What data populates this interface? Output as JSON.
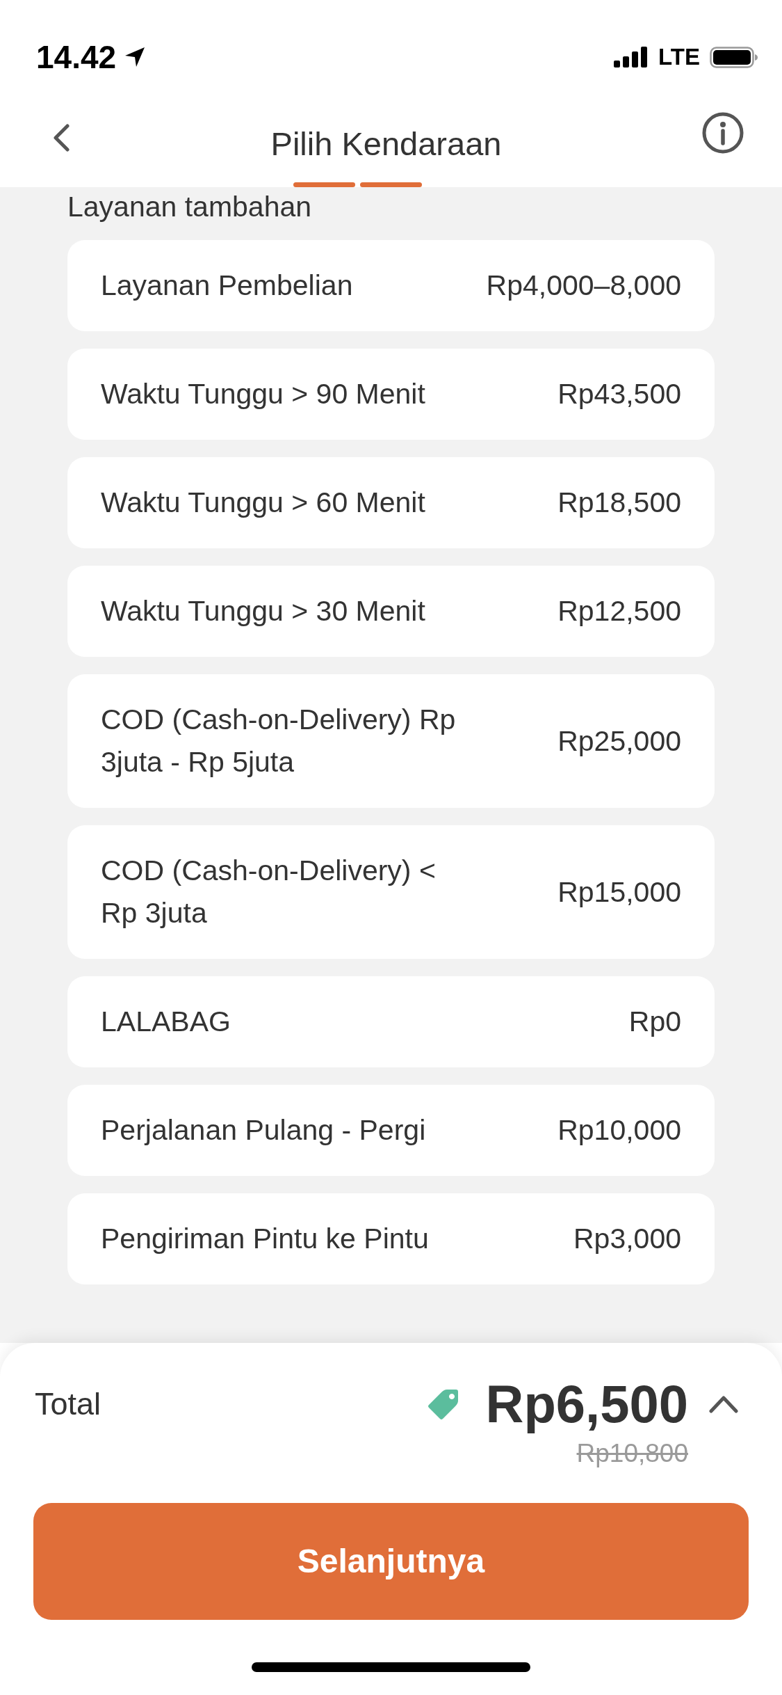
{
  "status_bar": {
    "time": "14.42",
    "network": "LTE"
  },
  "header": {
    "title": "Pilih Kendaraan",
    "steps": [
      {
        "done": true
      },
      {
        "done": true
      }
    ]
  },
  "section": {
    "title": "Layanan tambahan",
    "services": [
      {
        "name": "Layanan Pembelian",
        "price": "Rp4,000–8,000"
      },
      {
        "name": "Waktu Tunggu > 90 Menit",
        "price": "Rp43,500"
      },
      {
        "name": "Waktu Tunggu > 60 Menit",
        "price": "Rp18,500"
      },
      {
        "name": "Waktu Tunggu > 30 Menit",
        "price": "Rp12,500"
      },
      {
        "name": "COD (Cash-on-Delivery) Rp 3juta - Rp 5juta",
        "price": "Rp25,000"
      },
      {
        "name": "COD (Cash-on-Delivery) < Rp 3juta",
        "price": "Rp15,000"
      },
      {
        "name": "LALABAG",
        "price": "Rp0"
      },
      {
        "name": "Perjalanan Pulang - Pergi",
        "price": "Rp10,000"
      },
      {
        "name": "Pengiriman Pintu ke Pintu",
        "price": "Rp3,000"
      }
    ]
  },
  "footer": {
    "total_label": "Total",
    "price": "Rp6,500",
    "original_price": "Rp10,800",
    "button": "Selanjutnya"
  }
}
